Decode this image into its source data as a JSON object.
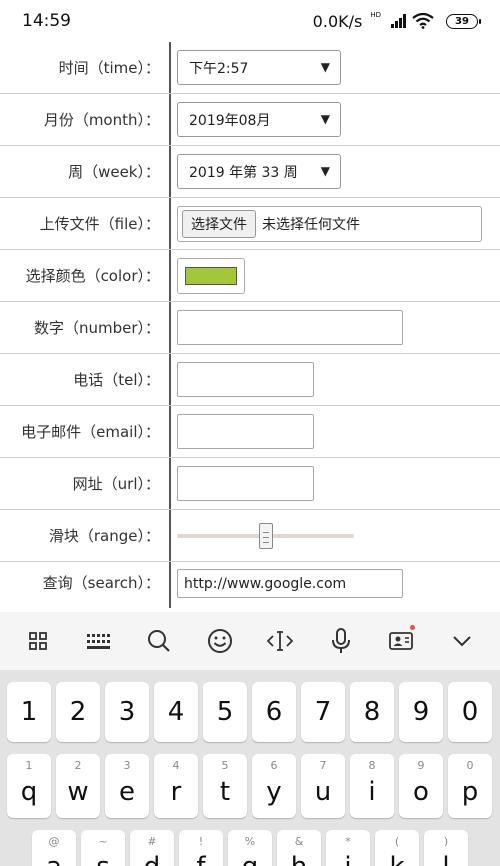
{
  "status_bar": {
    "time": "14:59",
    "network_speed": "0.0K/s",
    "network_badge": "HD",
    "battery": "39"
  },
  "form": {
    "time_label": "时间（time）：",
    "time_value": "下午2:57",
    "month_label": "月份（month）：",
    "month_value": "2019年08月",
    "week_label": "周（week）：",
    "week_value": "2019 年第 33 周",
    "file_label": "上传文件（file）：",
    "file_button": "选择文件",
    "file_status": "未选择任何文件",
    "color_label": "选择颜色（color）：",
    "color_value": "#a4c639",
    "number_label": "数字（number）：",
    "number_value": "",
    "tel_label": "电话（tel）：",
    "tel_value": "",
    "email_label": "电子邮件（email）：",
    "email_value": "",
    "url_label": "网址（url）：",
    "url_value": "",
    "range_label": "滑块（range）：",
    "range_value": 0.5,
    "search_label": "查询（search）：",
    "search_value": "http://www.google.com",
    "select_arrow": "▼"
  },
  "keyboard_toolbar": {
    "icons": [
      "grid-icon",
      "keyboard-icon",
      "search-icon",
      "emoji-icon",
      "cursor-icon",
      "microphone-icon",
      "contact-card-icon",
      "chevron-down-icon"
    ],
    "notification_color": "#e05a3a"
  },
  "keyboard": {
    "number_row": [
      "1",
      "2",
      "3",
      "4",
      "5",
      "6",
      "7",
      "8",
      "9",
      "0"
    ],
    "letter_row": [
      {
        "key": "q",
        "sub": "1"
      },
      {
        "key": "w",
        "sub": "2"
      },
      {
        "key": "e",
        "sub": "3"
      },
      {
        "key": "r",
        "sub": "4"
      },
      {
        "key": "t",
        "sub": "5"
      },
      {
        "key": "y",
        "sub": "6"
      },
      {
        "key": "u",
        "sub": "7"
      },
      {
        "key": "i",
        "sub": "8"
      },
      {
        "key": "o",
        "sub": "9"
      },
      {
        "key": "p",
        "sub": "0"
      }
    ],
    "third_row": [
      {
        "key": "a",
        "sub": "@"
      },
      {
        "key": "s",
        "sub": "~"
      },
      {
        "key": "d",
        "sub": "#"
      },
      {
        "key": "f",
        "sub": "!"
      },
      {
        "key": "g",
        "sub": "%"
      },
      {
        "key": "h",
        "sub": "&"
      },
      {
        "key": "j",
        "sub": "*"
      },
      {
        "key": "k",
        "sub": "("
      },
      {
        "key": "l",
        "sub": ")"
      }
    ]
  }
}
